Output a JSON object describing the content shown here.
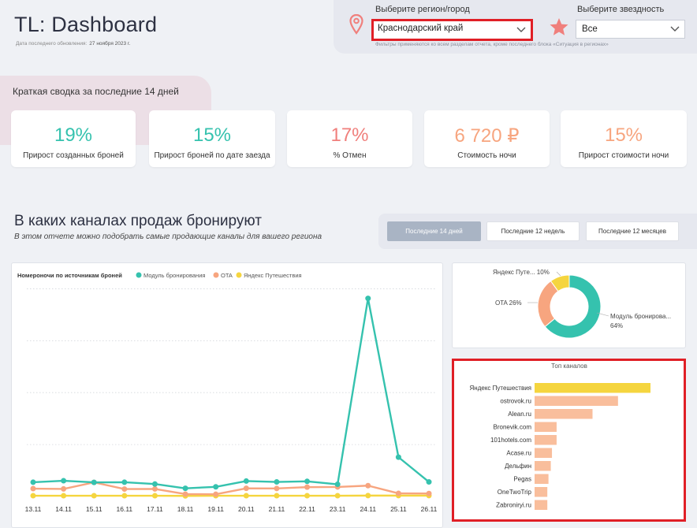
{
  "header": {
    "title": "TL: Dashboard",
    "updated_label": "Дата последнего обновления:",
    "updated_value": "27 ноября 2023 г."
  },
  "filters": {
    "region_label": "Выберите регион/город",
    "region_value": "Краснодарский край",
    "stars_label": "Выберите звездность",
    "stars_value": "Все",
    "note": "Фильтры применяются ко всем разделам отчета, кроме последнего блока «Ситуация в регионах»"
  },
  "summary": {
    "label": "Краткая сводка за последние 14 дней",
    "kpis": [
      {
        "value": "19%",
        "label": "Прирост созданных броней",
        "color": "#35c2ae"
      },
      {
        "value": "15%",
        "label": "Прирост броней по дате заезда",
        "color": "#35c2ae"
      },
      {
        "value": "17%",
        "label": "% Отмен",
        "color": "#f07f7c"
      },
      {
        "value": "6 720 ₽",
        "label": "Стоимость ночи",
        "color": "#f7a57f"
      },
      {
        "value": "15%",
        "label": "Прирост стоимости ночи",
        "color": "#f7a57f"
      }
    ]
  },
  "channels_section": {
    "title": "В каких каналах продаж бронируют",
    "subtitle": "В этом отчете можно подобрать самые продающие каналы для вашего региона",
    "buttons": [
      "Последние 14 дней",
      "Последние 12 недель",
      "Последние 12 месяцев"
    ],
    "active_button": 0
  },
  "colors": {
    "teal": "#35c2ae",
    "salmon": "#f7a57f",
    "yellow": "#f5d53f",
    "highlight": "#e01f26"
  },
  "chart_data": [
    {
      "type": "line",
      "title": "Номероночи по источникам броней",
      "categories": [
        "13.11",
        "14.11",
        "15.11",
        "16.11",
        "17.11",
        "18.11",
        "19.11",
        "20.11",
        "21.11",
        "22.11",
        "23.11",
        "24.11",
        "25.11",
        "26.11"
      ],
      "series": [
        {
          "name": "Модуль бронирования",
          "color": "#35c2ae",
          "values": [
            9.6,
            10.6,
            9.5,
            9.6,
            8.4,
            5.5,
            6.5,
            10.4,
            9.8,
            10.2,
            8.2,
            133.5,
            26.5,
            9.8
          ]
        },
        {
          "name": "OTA",
          "color": "#f7a57f",
          "values": [
            5.3,
            5.1,
            9.5,
            5.0,
            5.1,
            1.6,
            1.5,
            5.5,
            5.4,
            6.3,
            6.4,
            7.3,
            2.1,
            2.0
          ]
        },
        {
          "name": "Яндекс Путешествия",
          "color": "#f5d53f",
          "values": [
            0.5,
            0.5,
            0.5,
            0.5,
            0.5,
            0.4,
            0.5,
            0.5,
            0.5,
            0.5,
            0.5,
            0.6,
            0.6,
            0.6
          ]
        }
      ],
      "ylim": [
        0,
        145
      ],
      "grid": true,
      "legend": "top"
    },
    {
      "type": "pie",
      "categories": [
        "Модуль бронирова...",
        "OTA",
        "Яндекс Путе..."
      ],
      "labels": [
        "64%",
        "26%",
        "10%"
      ],
      "values": [
        64,
        26,
        10
      ],
      "colors": [
        "#35c2ae",
        "#f7a57f",
        "#f5d53f"
      ]
    },
    {
      "type": "bar",
      "title": "Топ каналов",
      "categories": [
        "Яндекс Путешествия",
        "ostrovok.ru",
        "Alean.ru",
        "Bronevik.com",
        "101hotels.com",
        "Acase.ru",
        "Дельфин",
        "Pegas",
        "OneTwoTrip",
        "Zabroniryi.ru"
      ],
      "values": [
        100,
        72,
        50,
        19,
        19,
        15,
        14,
        12,
        11,
        11
      ],
      "colors": [
        "#f5d53f",
        "#f9be9c",
        "#f9be9c",
        "#f9be9c",
        "#f9be9c",
        "#f9be9c",
        "#f9be9c",
        "#f9be9c",
        "#f9be9c",
        "#f9be9c"
      ],
      "xlim": [
        0,
        100
      ]
    }
  ]
}
